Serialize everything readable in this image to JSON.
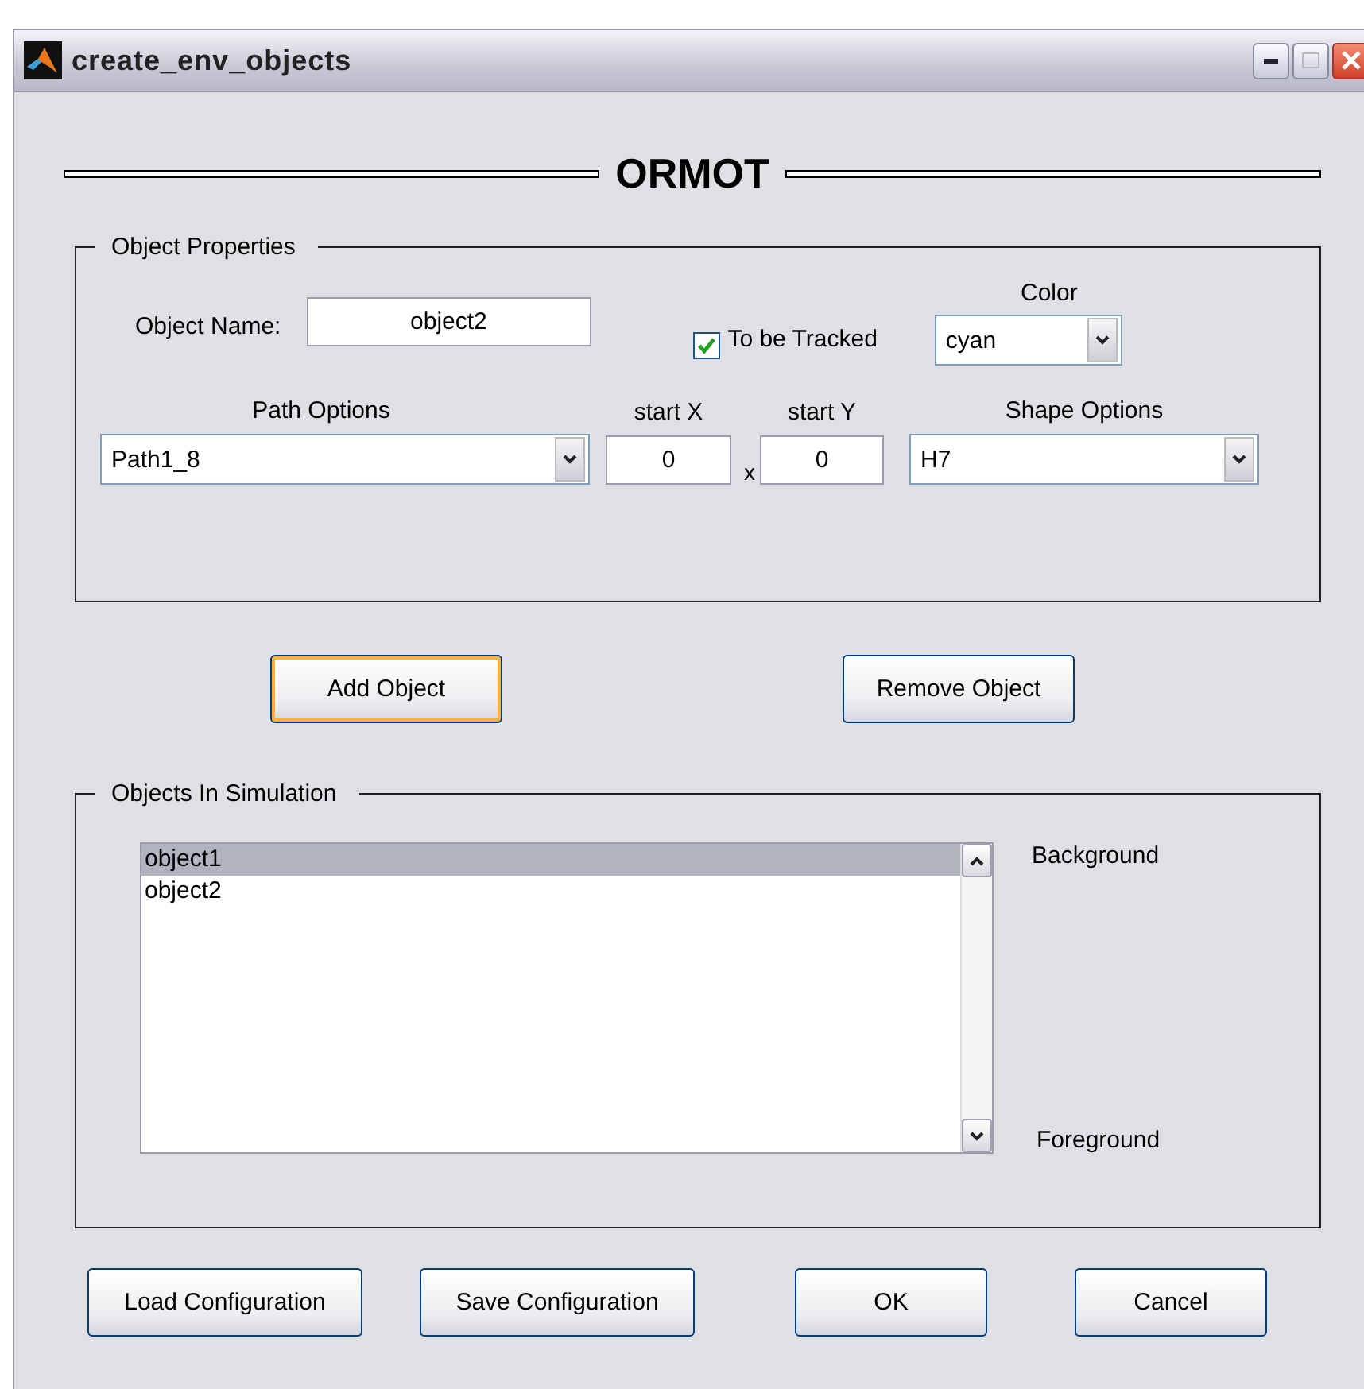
{
  "window": {
    "title": "create_env_objects"
  },
  "heading": "ORMOT",
  "object_properties": {
    "legend": "Object Properties",
    "object_name": {
      "label": "Object Name:",
      "value": "object2"
    },
    "to_be_tracked": {
      "label": "To be Tracked",
      "checked": true
    },
    "color": {
      "label": "Color",
      "value": "cyan"
    },
    "path_options": {
      "label": "Path Options",
      "value": "Path1_8"
    },
    "start_x": {
      "label": "start X",
      "value": "0"
    },
    "separator": "x",
    "start_y": {
      "label": "start Y",
      "value": "0"
    },
    "shape_options": {
      "label": "Shape Options",
      "value": "H7"
    }
  },
  "actions": [
    {
      "label": "Add Object",
      "focused": true
    },
    {
      "label": "Remove Object",
      "focused": false
    }
  ],
  "objects_in_simulation": {
    "legend": "Objects In Simulation",
    "items": [
      {
        "label": "object1",
        "selected": true
      },
      {
        "label": "object2",
        "selected": false
      }
    ],
    "top_label": "Background",
    "bottom_label": "Foreground"
  },
  "buttons": [
    "Load Configuration",
    "Save Configuration",
    "OK",
    "Cancel"
  ]
}
